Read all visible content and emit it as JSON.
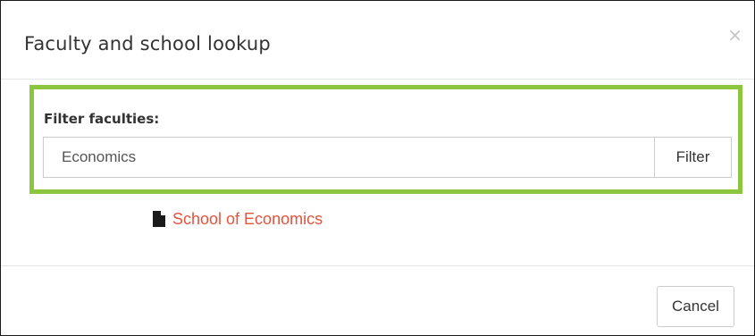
{
  "modal": {
    "title": "Faculty and school lookup",
    "close_symbol": "×"
  },
  "filter": {
    "label": "Filter faculties:",
    "input_value": "Economics",
    "button_label": "Filter",
    "highlight_color": "#8cc63f"
  },
  "results": [
    {
      "label": "School of Economics",
      "icon": "file-icon",
      "color": "#e5533d"
    }
  ],
  "footer": {
    "cancel_label": "Cancel"
  }
}
